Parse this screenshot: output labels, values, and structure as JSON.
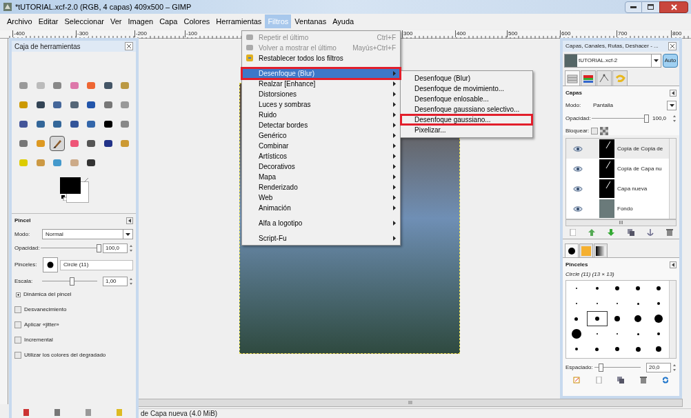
{
  "window": {
    "title": "*tUTORIAL.xcf-2.0 (RGB, 4 capas) 409x500 – GIMP"
  },
  "menu_bar": [
    {
      "label": "Archivo",
      "selected": false
    },
    {
      "label": "Editar",
      "selected": false
    },
    {
      "label": "Seleccionar",
      "selected": false
    },
    {
      "label": "Ver",
      "selected": false
    },
    {
      "label": "Imagen",
      "selected": false
    },
    {
      "label": "Capa",
      "selected": false
    },
    {
      "label": "Colores",
      "selected": false
    },
    {
      "label": "Herramientas",
      "selected": false
    },
    {
      "label": "Filtros",
      "selected": true
    },
    {
      "label": "Ventanas",
      "selected": false
    },
    {
      "label": "Ayuda",
      "selected": false
    }
  ],
  "ruler": {
    "left_labels": [
      "-400",
      "-300",
      "-200",
      "-100"
    ],
    "right_labels": [
      "300",
      "400",
      "500",
      "600",
      "700",
      "800"
    ]
  },
  "toolbox": {
    "title": "Caja de herramientas",
    "tools": [
      {
        "selected": false
      },
      {
        "selected": false
      },
      {
        "selected": false
      },
      {
        "selected": false
      },
      {
        "selected": false
      },
      {
        "selected": false
      },
      {
        "selected": false
      },
      {
        "selected": false
      },
      {
        "selected": false
      },
      {
        "selected": false
      },
      {
        "selected": false
      },
      {
        "selected": false
      },
      {
        "selected": false
      },
      {
        "selected": false
      },
      {
        "selected": false
      },
      {
        "selected": false
      },
      {
        "selected": false
      },
      {
        "selected": false
      },
      {
        "selected": false
      },
      {
        "selected": false
      },
      {
        "selected": false
      },
      {
        "selected": false
      },
      {
        "selected": false
      },
      {
        "selected": true
      },
      {
        "selected": false
      },
      {
        "selected": false
      },
      {
        "selected": false
      },
      {
        "selected": false
      },
      {
        "selected": false
      },
      {
        "selected": false
      },
      {
        "selected": false
      },
      {
        "selected": false
      },
      {
        "selected": false
      }
    ],
    "options": {
      "title": "Pincel",
      "mode_label": "Modo:",
      "mode": "Normal",
      "opacity_label": "Opacidad:",
      "opacity": {
        "level": 1.0,
        "value": "100,0"
      },
      "brush_label": "Pinceles:",
      "brush": "Circle (11)",
      "scale_label": "Escala:",
      "scale": {
        "level": 0.5,
        "value": "1,00"
      },
      "expander": {
        "label": "Dinámica del pincel"
      },
      "checkboxes": [
        {
          "label": "Desvanecimiento",
          "checked": false
        },
        {
          "label": "Aplicar «jitter»",
          "checked": false
        },
        {
          "label": "Incremental",
          "checked": false
        },
        {
          "label": "Utilizar los colores del degradado",
          "checked": false
        }
      ]
    }
  },
  "filters_menu": [
    {
      "kind": "action",
      "label": "Repetir el último",
      "shortcut": "Ctrl+F",
      "disabled": true
    },
    {
      "kind": "action",
      "label": "Volver a mostrar el último",
      "shortcut": "Mayús+Ctrl+F",
      "disabled": true
    },
    {
      "kind": "action",
      "label": "Restablecer todos los filtros",
      "disabled": false
    },
    {
      "kind": "separator"
    },
    {
      "kind": "submenu",
      "label": "Desenfoque (Blur)",
      "selected": true,
      "marked": true
    },
    {
      "kind": "submenu",
      "label": "Realzar [Enhance]",
      "selected": false,
      "marked": false
    },
    {
      "kind": "submenu",
      "label": "Distorsiones",
      "selected": false,
      "marked": false
    },
    {
      "kind": "submenu",
      "label": "Luces y sombras",
      "selected": false,
      "marked": false
    },
    {
      "kind": "submenu",
      "label": "Ruido",
      "selected": false,
      "marked": false
    },
    {
      "kind": "submenu",
      "label": "Detectar bordes",
      "selected": false,
      "marked": false
    },
    {
      "kind": "submenu",
      "label": "Genérico",
      "selected": false,
      "marked": false
    },
    {
      "kind": "submenu",
      "label": "Combinar",
      "selected": false,
      "marked": false
    },
    {
      "kind": "submenu",
      "label": "Artísticos",
      "selected": false,
      "marked": false
    },
    {
      "kind": "submenu",
      "label": "Decorativos",
      "selected": false,
      "marked": false
    },
    {
      "kind": "submenu",
      "label": "Mapa",
      "selected": false,
      "marked": false
    },
    {
      "kind": "submenu",
      "label": "Renderizado",
      "selected": false,
      "marked": false
    },
    {
      "kind": "submenu",
      "label": "Web",
      "selected": false,
      "marked": false
    },
    {
      "kind": "submenu",
      "label": "Animación",
      "selected": false,
      "marked": false
    },
    {
      "kind": "separator"
    },
    {
      "kind": "submenu",
      "label": "Alfa a logotipo",
      "selected": false,
      "marked": false
    },
    {
      "kind": "separator"
    },
    {
      "kind": "submenu",
      "label": "Script-Fu",
      "selected": false,
      "marked": false
    }
  ],
  "blur_submenu": [
    {
      "label": "Desenfoque (Blur)",
      "marked": false
    },
    {
      "label": "Desenfoque de movimiento...",
      "marked": false
    },
    {
      "label": "Desenfoque enlosable...",
      "marked": false
    },
    {
      "label": "Desenfoque gaussiano selectivo...",
      "marked": false
    },
    {
      "label": "Desenfoque gaussiano...",
      "marked": true
    },
    {
      "label": "Pixelizar...",
      "marked": false
    }
  ],
  "status_bar": {
    "text": "de Capa nueva (4.0 MiB)",
    "scrollbar_label": "III"
  },
  "dock": {
    "title": "Capas, Canales, Rutas, Deshacer - ...",
    "image": "tUTORIAL.xcf-2",
    "auto_button": "Auto",
    "tabs": [
      {
        "selected": true
      },
      {
        "selected": false
      },
      {
        "selected": false
      },
      {
        "selected": false
      }
    ],
    "layers_panel": {
      "title": "Capas",
      "mode_label": "Modo:",
      "mode": "Pantalla",
      "opacity_label": "Opacidad:",
      "opacity": {
        "level": 1.0,
        "value": "100,0"
      },
      "lock_label": "Bloquear:",
      "lock_checked": false,
      "layers": [
        {
          "name": "Copia de Copia de",
          "visible": true,
          "selected": true
        },
        {
          "name": "Copia de Capa nu",
          "visible": true,
          "selected": false
        },
        {
          "name": "Capa nueva",
          "visible": true,
          "selected": false
        },
        {
          "name": "Fondo",
          "visible": true,
          "selected": false
        }
      ],
      "scrollbar_label": "III"
    },
    "brush_tabs": [
      {
        "selected": true
      },
      {
        "selected": false
      },
      {
        "selected": false
      }
    ],
    "brushes_panel": {
      "title": "Pinceles",
      "brush_name": "Circle (11) (13 × 13)",
      "brushes": [
        {
          "selected": false
        },
        {
          "selected": false
        },
        {
          "selected": false
        },
        {
          "selected": false
        },
        {
          "selected": false
        },
        {
          "selected": false
        },
        {
          "selected": false
        },
        {
          "selected": false
        },
        {
          "selected": false
        },
        {
          "selected": false
        },
        {
          "selected": false
        },
        {
          "selected": true
        },
        {
          "selected": false
        },
        {
          "selected": false
        },
        {
          "selected": false
        },
        {
          "selected": false
        },
        {
          "selected": false
        },
        {
          "selected": false
        },
        {
          "selected": false
        },
        {
          "selected": false
        },
        {
          "selected": false
        },
        {
          "selected": false
        },
        {
          "selected": false
        },
        {
          "selected": false
        },
        {
          "selected": false
        }
      ],
      "spacing_label": "Espaciado:",
      "spacing": {
        "level": 0.1,
        "value": "20,0"
      }
    }
  }
}
